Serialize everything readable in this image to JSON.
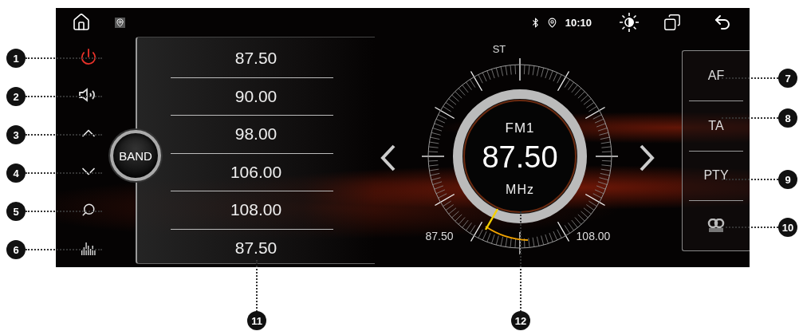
{
  "status_bar": {
    "time": "10:10"
  },
  "side_buttons": [
    {
      "kind": "power",
      "callout": "1"
    },
    {
      "kind": "speaker",
      "callout": "2"
    },
    {
      "kind": "up",
      "callout": "3"
    },
    {
      "kind": "down",
      "callout": "4"
    },
    {
      "kind": "search",
      "callout": "5"
    },
    {
      "kind": "equalizer",
      "callout": "6"
    }
  ],
  "band_button": {
    "label": "BAND"
  },
  "preset_list": {
    "callout": "11",
    "presets": [
      {
        "frequency": "87.50"
      },
      {
        "frequency": "90.00"
      },
      {
        "frequency": "98.00"
      },
      {
        "frequency": "106.00"
      },
      {
        "frequency": "108.00"
      },
      {
        "frequency": "87.50"
      }
    ]
  },
  "dial": {
    "stereo": "ST",
    "band": "FM1",
    "frequency": "87.50",
    "unit": "MHz",
    "min": "87.50",
    "max": "108.00",
    "callout": "12"
  },
  "right_buttons": [
    {
      "kind": "text",
      "label": "AF",
      "callout": "7"
    },
    {
      "kind": "text",
      "label": "TA",
      "callout": "8"
    },
    {
      "kind": "text",
      "label": "PTY",
      "callout": "9"
    },
    {
      "kind": "rds",
      "callout": "10"
    }
  ]
}
